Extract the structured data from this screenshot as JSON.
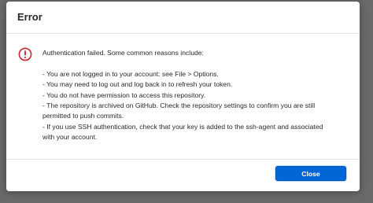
{
  "dialog": {
    "title": "Error",
    "icon": "error-circle-icon",
    "icon_color": "#cb2431",
    "message": {
      "intro": "Authentication failed. Some common reasons include:",
      "reasons": [
        "- You are not logged in to your account: see File > Options.",
        "- You may need to log out and log back in to refresh your token.",
        "- You do not have permission to access this repository.",
        "- The repository is archived on GitHub. Check the repository settings to confirm you are still",
        "permitted to push commits.",
        "- If you use SSH authentication, check that your key is added to the ssh-agent and associated",
        "with your account."
      ]
    },
    "close_label": "Close",
    "accent_color": "#0366d6"
  }
}
